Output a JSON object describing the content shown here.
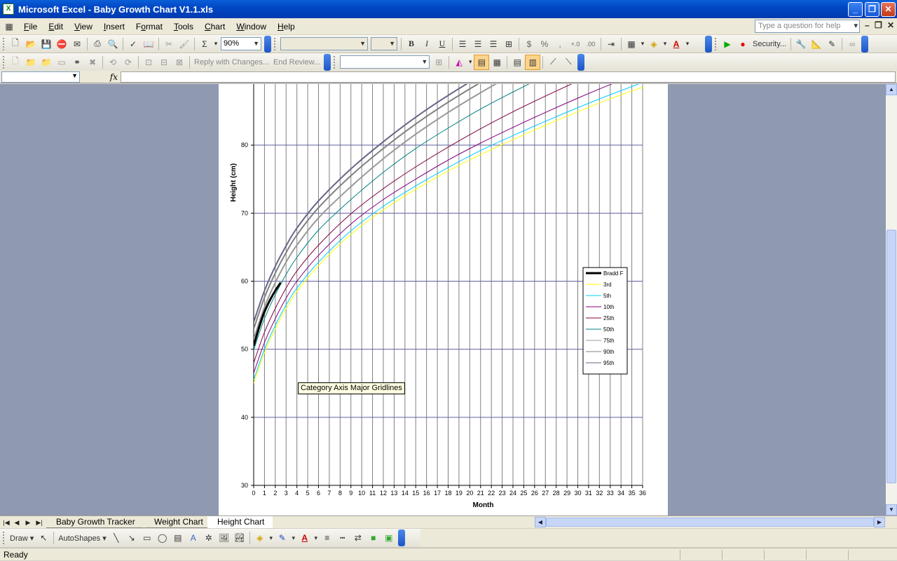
{
  "window": {
    "title": "Microsoft Excel - Baby Growth Chart V1.1.xls",
    "app_icon": "excel-icon",
    "minimize": "_",
    "maximize": "❐",
    "close": "✕"
  },
  "menu": {
    "items": [
      {
        "label": "File",
        "u": "F"
      },
      {
        "label": "Edit",
        "u": "E"
      },
      {
        "label": "View",
        "u": "V"
      },
      {
        "label": "Insert",
        "u": "I"
      },
      {
        "label": "Format",
        "u": "o"
      },
      {
        "label": "Tools",
        "u": "T"
      },
      {
        "label": "Chart",
        "u": "C"
      },
      {
        "label": "Window",
        "u": "W"
      },
      {
        "label": "Help",
        "u": "H"
      }
    ],
    "help_placeholder": "Type a question for help"
  },
  "toolbar1": {
    "zoom": "90%",
    "bold": "B",
    "italic": "I",
    "underline": "U",
    "currency": "$",
    "percent": "%",
    "comma": ",",
    "inc_decimal": "+.0",
    "dec_decimal": ".00",
    "sum": "Σ",
    "security_label": "Security..."
  },
  "toolbar2": {
    "reply_label": "Reply with Changes...",
    "end_review_label": "End Review..."
  },
  "formula": {
    "fx": "fx",
    "namebox": "",
    "value": ""
  },
  "chart_data": {
    "type": "line",
    "title": "",
    "xlabel": "Month",
    "ylabel": "Height (cm)",
    "ylim": [
      30,
      90
    ],
    "xlim": [
      0,
      36
    ],
    "yticks": [
      30,
      40,
      50,
      60,
      70,
      80
    ],
    "grid": "major gridlines on both axes",
    "legend_position": "right",
    "series": [
      {
        "name": "Bradd F",
        "color": "#000000",
        "x": [
          0,
          0.5,
          1,
          1.5,
          2,
          2.5
        ],
        "values": [
          50.5,
          53.2,
          55.5,
          57.2,
          58.6,
          59.8
        ]
      },
      {
        "name": "3rd",
        "color": "#ffff00",
        "x": [
          0,
          1,
          2,
          3,
          4,
          6,
          9,
          12,
          15,
          18,
          21,
          24,
          27,
          30,
          33,
          36
        ],
        "values": [
          45,
          49.5,
          53,
          56,
          58.5,
          62.3,
          66.9,
          70.5,
          73.5,
          76.2,
          78.6,
          80.8,
          82.9,
          84.9,
          86.8,
          88.5
        ]
      },
      {
        "name": "5th",
        "color": "#00ccff",
        "x": [
          0,
          1,
          2,
          3,
          4,
          6,
          9,
          12,
          15,
          18,
          21,
          24,
          27,
          30,
          33,
          36
        ],
        "values": [
          45.5,
          50,
          53.5,
          56.5,
          59,
          62.8,
          67.4,
          71,
          74,
          76.7,
          79.2,
          81.4,
          83.5,
          85.5,
          87.4,
          89.2
        ]
      },
      {
        "name": "10th",
        "color": "#800080",
        "x": [
          0,
          1,
          2,
          3,
          4,
          6,
          9,
          12,
          15,
          18,
          21,
          24,
          27,
          30,
          33,
          36
        ],
        "values": [
          46.5,
          51,
          54.5,
          57.5,
          60,
          63.8,
          68.4,
          72,
          75,
          77.8,
          80.3,
          82.6,
          84.8,
          86.9,
          88.9,
          90.8
        ]
      },
      {
        "name": "25th",
        "color": "#800040",
        "x": [
          0,
          1,
          2,
          3,
          4,
          6,
          9,
          12,
          15,
          18,
          21,
          24,
          27,
          30,
          33,
          36
        ],
        "values": [
          48,
          52.5,
          56,
          59,
          61.5,
          65.3,
          69.9,
          73.6,
          76.8,
          79.7,
          82.4,
          84.9,
          87.2,
          89.4,
          91.5,
          93.5
        ]
      },
      {
        "name": "50th",
        "color": "#008080",
        "x": [
          0,
          1,
          2,
          3,
          4,
          6,
          9,
          12,
          15,
          18,
          21,
          24,
          27,
          30,
          33,
          36
        ],
        "values": [
          49.9,
          54.5,
          58,
          61,
          63.5,
          67.5,
          72,
          76,
          79.5,
          82.5,
          85.3,
          87.8,
          90.2,
          92.5,
          94.7,
          96.8
        ]
      },
      {
        "name": "75th",
        "color": "#999999",
        "x": [
          0,
          1,
          2,
          3,
          4,
          6,
          9,
          12,
          15,
          18,
          21,
          24,
          27,
          30,
          33,
          36
        ],
        "values": [
          51.5,
          56.2,
          59.8,
          62.8,
          65.3,
          69.3,
          73.9,
          78,
          81.6,
          84.8,
          87.7,
          90.4,
          92.9,
          95.3,
          97.6,
          99.8
        ]
      },
      {
        "name": "90th",
        "color": "#808080",
        "x": [
          0,
          1,
          2,
          3,
          4,
          6,
          9,
          12,
          15,
          18,
          21,
          24,
          27,
          30,
          33,
          36
        ],
        "values": [
          53,
          57.6,
          61.2,
          64.2,
          66.8,
          70.8,
          75.5,
          79.5,
          83.1,
          86.3,
          89.2,
          91.9,
          94.4,
          96.8,
          99.1,
          101.3
        ]
      },
      {
        "name": "95th",
        "color": "#666688",
        "x": [
          0,
          1,
          2,
          3,
          4,
          6,
          9,
          12,
          15,
          18,
          21,
          24,
          27,
          30,
          33,
          36
        ],
        "values": [
          54,
          58.6,
          62.2,
          65.2,
          67.8,
          71.8,
          76.5,
          80.5,
          84.1,
          87.3,
          90.2,
          92.9,
          95.4,
          97.8,
          100.1,
          102.3
        ]
      }
    ]
  },
  "tooltip": "Category Axis Major Gridlines",
  "tabs": {
    "items": [
      "Baby Growth Tracker",
      "Weight Chart",
      "Height Chart"
    ],
    "active": 2
  },
  "drawbar": {
    "draw_label": "Draw",
    "autoshapes_label": "AutoShapes"
  },
  "status": {
    "text": "Ready"
  }
}
